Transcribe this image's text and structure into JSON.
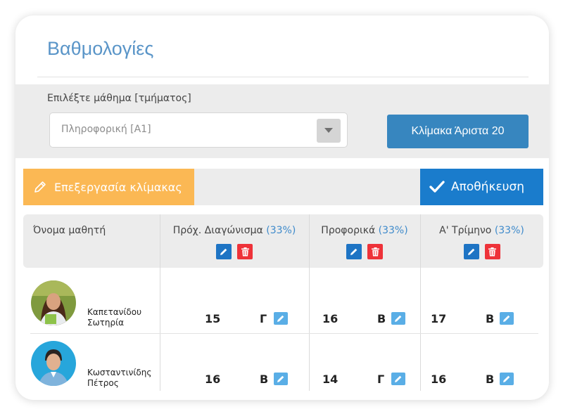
{
  "page": {
    "title": "Βαθμολογίες"
  },
  "filter": {
    "label": "Επιλέξτε μάθημα [τμήματος]",
    "select_value": "Πληροφορική [Α1]",
    "scale_button": "Κλίμακα Άριστα 20"
  },
  "toolbar": {
    "edit_scale_label": "Επεξεργασία κλίμακας",
    "save_label": "Αποθήκευση"
  },
  "table": {
    "student_header": "Όνομα μαθητή",
    "columns": [
      {
        "label": "Πρόχ. Διαγώνισμα",
        "weight": "(33%)"
      },
      {
        "label": "Προφορικά",
        "weight": "(33%)"
      },
      {
        "label": "Α' Τρίμηνο",
        "weight": "(33%)"
      }
    ],
    "rows": [
      {
        "name_line1": "Καπετανίδου",
        "name_line2": "Σωτηρία",
        "grades": [
          {
            "value": "15",
            "letter": "Γ"
          },
          {
            "value": "16",
            "letter": "Β"
          },
          {
            "value": "17",
            "letter": "Β"
          }
        ]
      },
      {
        "name_line1": "Κωσταντινίδης",
        "name_line2": "Πέτρος",
        "grades": [
          {
            "value": "16",
            "letter": "Β"
          },
          {
            "value": "14",
            "letter": "Γ"
          },
          {
            "value": "16",
            "letter": "Β"
          }
        ]
      }
    ]
  },
  "colors": {
    "accent_blue": "#3786bf",
    "save_blue": "#1a7ccc",
    "edit_orange": "#fbb854",
    "delete_red": "#ee3239",
    "title_blue": "#5a95c8"
  },
  "icons": [
    "pencil-icon",
    "checkmark-icon",
    "caret-down-icon",
    "trash-icon",
    "avatar-student-female",
    "avatar-student-male"
  ]
}
